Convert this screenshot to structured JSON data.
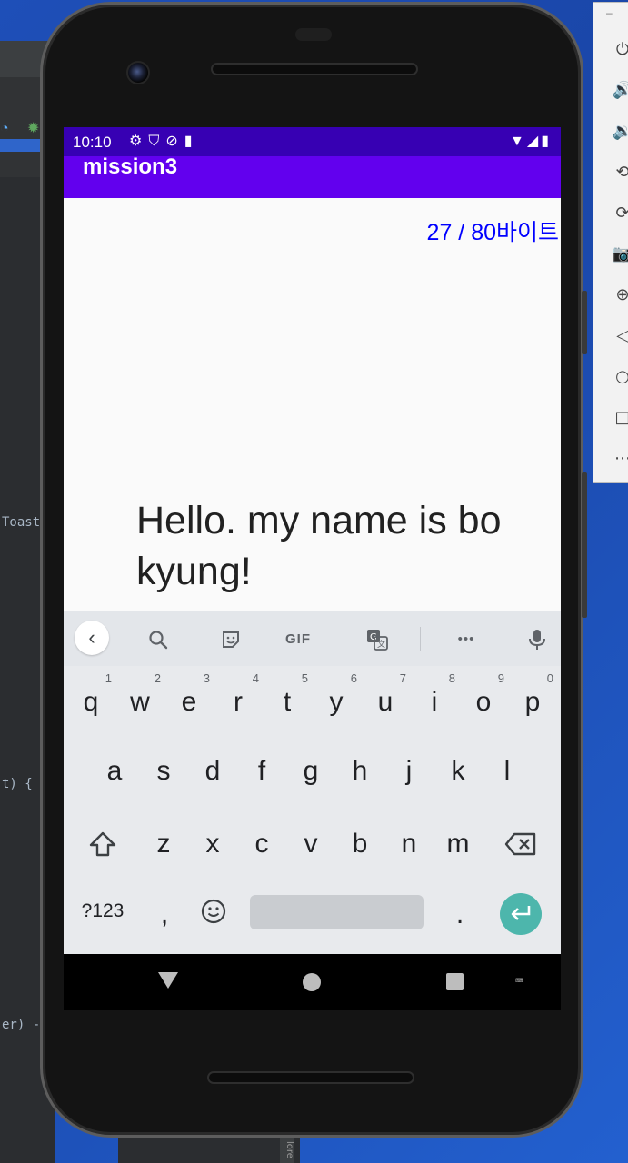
{
  "ide": {
    "code_lines": [
      "Toast",
      "t) {",
      "er) -"
    ]
  },
  "bottom_strip": {
    "tag": "lore"
  },
  "side_panel": {
    "items": [
      "power-icon",
      "volume-up-icon",
      "volume-down-icon",
      "rotate-left-icon",
      "rotate-right-icon",
      "camera-icon",
      "zoom-icon",
      "back-icon",
      "home-icon",
      "overview-icon",
      "more-icon"
    ]
  },
  "status_bar": {
    "time": "10:10"
  },
  "app": {
    "title": "mission3",
    "byte_counter": "27 / 80바이트",
    "message": "Hello. my name is bo kyung!"
  },
  "keyboard": {
    "toolbar": {
      "back": "‹",
      "gif": "GIF",
      "more": "•••"
    },
    "row1": [
      {
        "k": "q",
        "h": "1"
      },
      {
        "k": "w",
        "h": "2"
      },
      {
        "k": "e",
        "h": "3"
      },
      {
        "k": "r",
        "h": "4"
      },
      {
        "k": "t",
        "h": "5"
      },
      {
        "k": "y",
        "h": "6"
      },
      {
        "k": "u",
        "h": "7"
      },
      {
        "k": "i",
        "h": "8"
      },
      {
        "k": "o",
        "h": "9"
      },
      {
        "k": "p",
        "h": "0"
      }
    ],
    "row2": [
      "a",
      "s",
      "d",
      "f",
      "g",
      "h",
      "j",
      "k",
      "l"
    ],
    "row3": [
      "z",
      "x",
      "c",
      "v",
      "b",
      "n",
      "m"
    ],
    "row4": {
      "symbols": "?123",
      "comma": ",",
      "period": "."
    }
  },
  "nav": {
    "keyboard_glyph": "⌨"
  },
  "colors": {
    "status_bar": "#3700b3",
    "app_bar": "#6200ee",
    "counter": "#0000ff",
    "enter_key": "#4db6ac"
  }
}
